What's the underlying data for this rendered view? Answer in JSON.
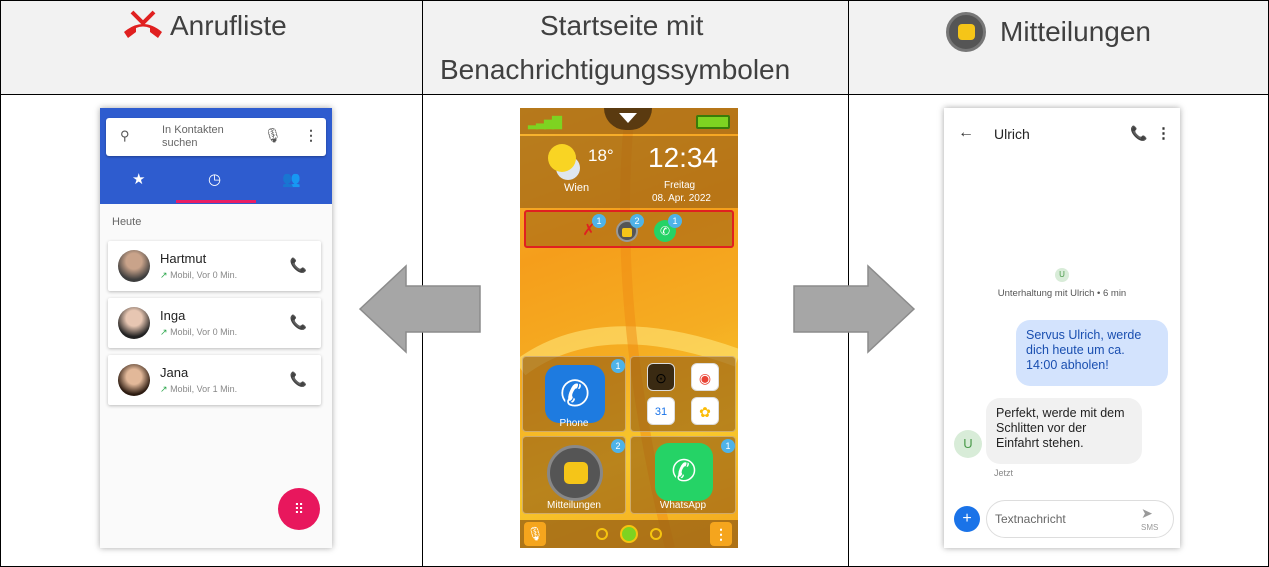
{
  "headers": {
    "left": "Anrufliste",
    "middle_line1": "Startseite mit",
    "middle_line2": "Benachrichtigungssymbolen",
    "right": "Mitteilungen"
  },
  "call_log": {
    "search_placeholder": "In Kontakten suchen",
    "section": "Heute",
    "calls": [
      {
        "name": "Hartmut",
        "detail": "Mobil, Vor 0 Min."
      },
      {
        "name": "Inga",
        "detail": "Mobil, Vor 0 Min."
      },
      {
        "name": "Jana",
        "detail": "Mobil, Vor 1 Min."
      }
    ]
  },
  "home": {
    "temperature": "18°",
    "city": "Wien",
    "time": "12:34",
    "weekday": "Freitag",
    "date": "08. Apr. 2022",
    "notif_badges": {
      "missed_call": "1",
      "messages": "2",
      "whatsapp": "1"
    },
    "tiles": {
      "phone_label": "Phone",
      "phone_badge": "1",
      "messages_label": "Mitteilungen",
      "messages_badge": "2",
      "whatsapp_label": "WhatsApp",
      "whatsapp_badge": "1"
    }
  },
  "conversation": {
    "contact": "Ulrich",
    "avatar_letter": "U",
    "meta": "Unterhaltung mit Ulrich • 6 min",
    "outgoing": "Servus Ulrich, werde dich heute um ca. 14:00 abholen!",
    "incoming": "Perfekt, werde mit dem Schlitten vor der Einfahrt stehen.",
    "incoming_time": "Jetzt",
    "input_placeholder": "Textnachricht",
    "send_label": "SMS"
  },
  "colors": {
    "header_bg": "#f2f2f2",
    "contacts_blue": "#2e5ccf",
    "accent_pink": "#e8175d",
    "launcher_orange": "#f5a51d",
    "highlight_red": "#e02020",
    "arrow_gray": "#a6a6a6"
  }
}
